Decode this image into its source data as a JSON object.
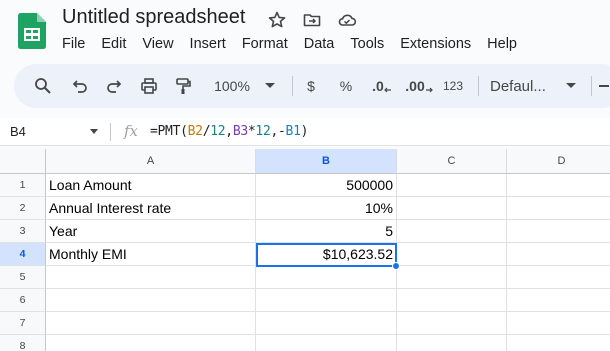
{
  "app": {
    "title": "Untitled spreadsheet",
    "menu": [
      "File",
      "Edit",
      "View",
      "Insert",
      "Format",
      "Data",
      "Tools",
      "Extensions",
      "Help"
    ]
  },
  "toolbar": {
    "zoom": "100%",
    "currency": "$",
    "percent": "%",
    "decrease_decimal": ".0",
    "increase_decimal": ".00",
    "number_format": "123",
    "font": "Defaul..."
  },
  "formula_bar": {
    "name_box": "B4",
    "fx": "fx",
    "formula_parts": [
      "=PMT(",
      "B2",
      "/",
      "12",
      ",",
      "B3",
      "*",
      "12",
      ",-",
      "B1",
      ")"
    ]
  },
  "grid": {
    "columns": [
      "A",
      "B",
      "C",
      "D"
    ],
    "rows": [
      "1",
      "2",
      "3",
      "4",
      "5",
      "6",
      "7",
      "8"
    ],
    "selected_cell": "B4",
    "cells": [
      [
        "Loan Amount",
        "500000"
      ],
      [
        "Annual Interest rate",
        "10%"
      ],
      [
        "Year",
        "5"
      ],
      [
        "Monthly EMI",
        "$10,623.52"
      ]
    ]
  }
}
